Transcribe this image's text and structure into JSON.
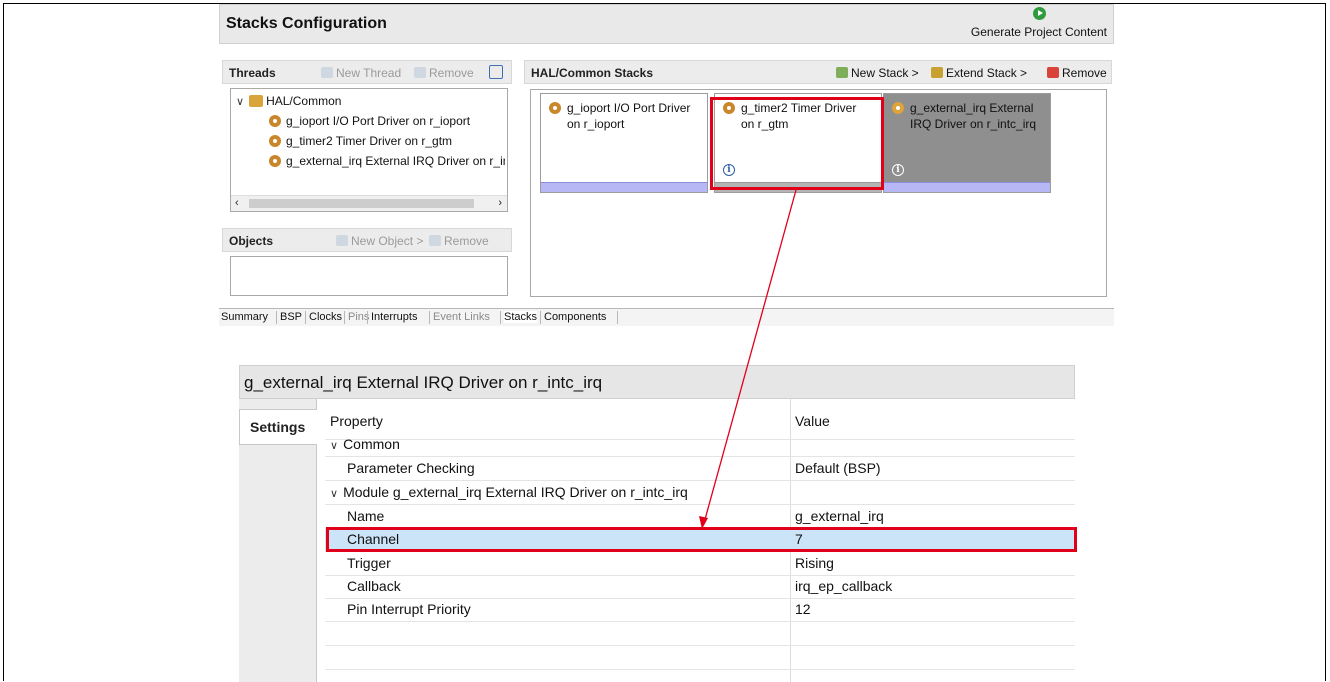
{
  "stacks_config": {
    "title": "Stacks Configuration",
    "generate_label": "Generate Project Content"
  },
  "threads": {
    "title": "Threads",
    "new_thread": "New Thread",
    "remove": "Remove",
    "root": "HAL/Common",
    "items": [
      "g_ioport I/O Port Driver on r_ioport",
      "g_timer2 Timer Driver on r_gtm",
      "g_external_irq External IRQ Driver on r_int"
    ]
  },
  "objects": {
    "title": "Objects",
    "new_object": "New Object >",
    "remove": "Remove"
  },
  "hal_stacks": {
    "title": "HAL/Common Stacks",
    "new_stack": "New Stack >",
    "extend_stack": "Extend Stack >",
    "remove": "Remove",
    "cards": [
      {
        "line1": "g_ioport I/O Port Driver",
        "line2": "on r_ioport"
      },
      {
        "line1": "g_timer2 Timer Driver",
        "line2": "on r_gtm",
        "info": "i"
      },
      {
        "line1": "g_external_irq External",
        "line2": "IRQ Driver on r_intc_irq",
        "info": "i"
      }
    ]
  },
  "tabs": [
    "Summary",
    "BSP",
    "Clocks",
    "Pins",
    "Interrupts",
    "Event Links",
    "Stacks",
    "Components"
  ],
  "properties": {
    "title": "g_external_irq External IRQ Driver on r_intc_irq",
    "settings_tab": "Settings",
    "col_property": "Property",
    "col_value": "Value",
    "rows": [
      {
        "label": "Common",
        "value": ""
      },
      {
        "label": "Parameter Checking",
        "value": "Default (BSP)"
      },
      {
        "label": "Module g_external_irq External IRQ Driver on r_intc_irq",
        "value": ""
      },
      {
        "label": "Name",
        "value": "g_external_irq"
      },
      {
        "label": "Channel",
        "value": "7"
      },
      {
        "label": "Trigger",
        "value": "Rising"
      },
      {
        "label": "Callback",
        "value": "irq_ep_callback"
      },
      {
        "label": "Pin Interrupt Priority",
        "value": "12"
      }
    ]
  },
  "colors": {
    "highlight": "#e0001a",
    "arrow": "#e0001a",
    "selected_row": "#cce4f7"
  }
}
